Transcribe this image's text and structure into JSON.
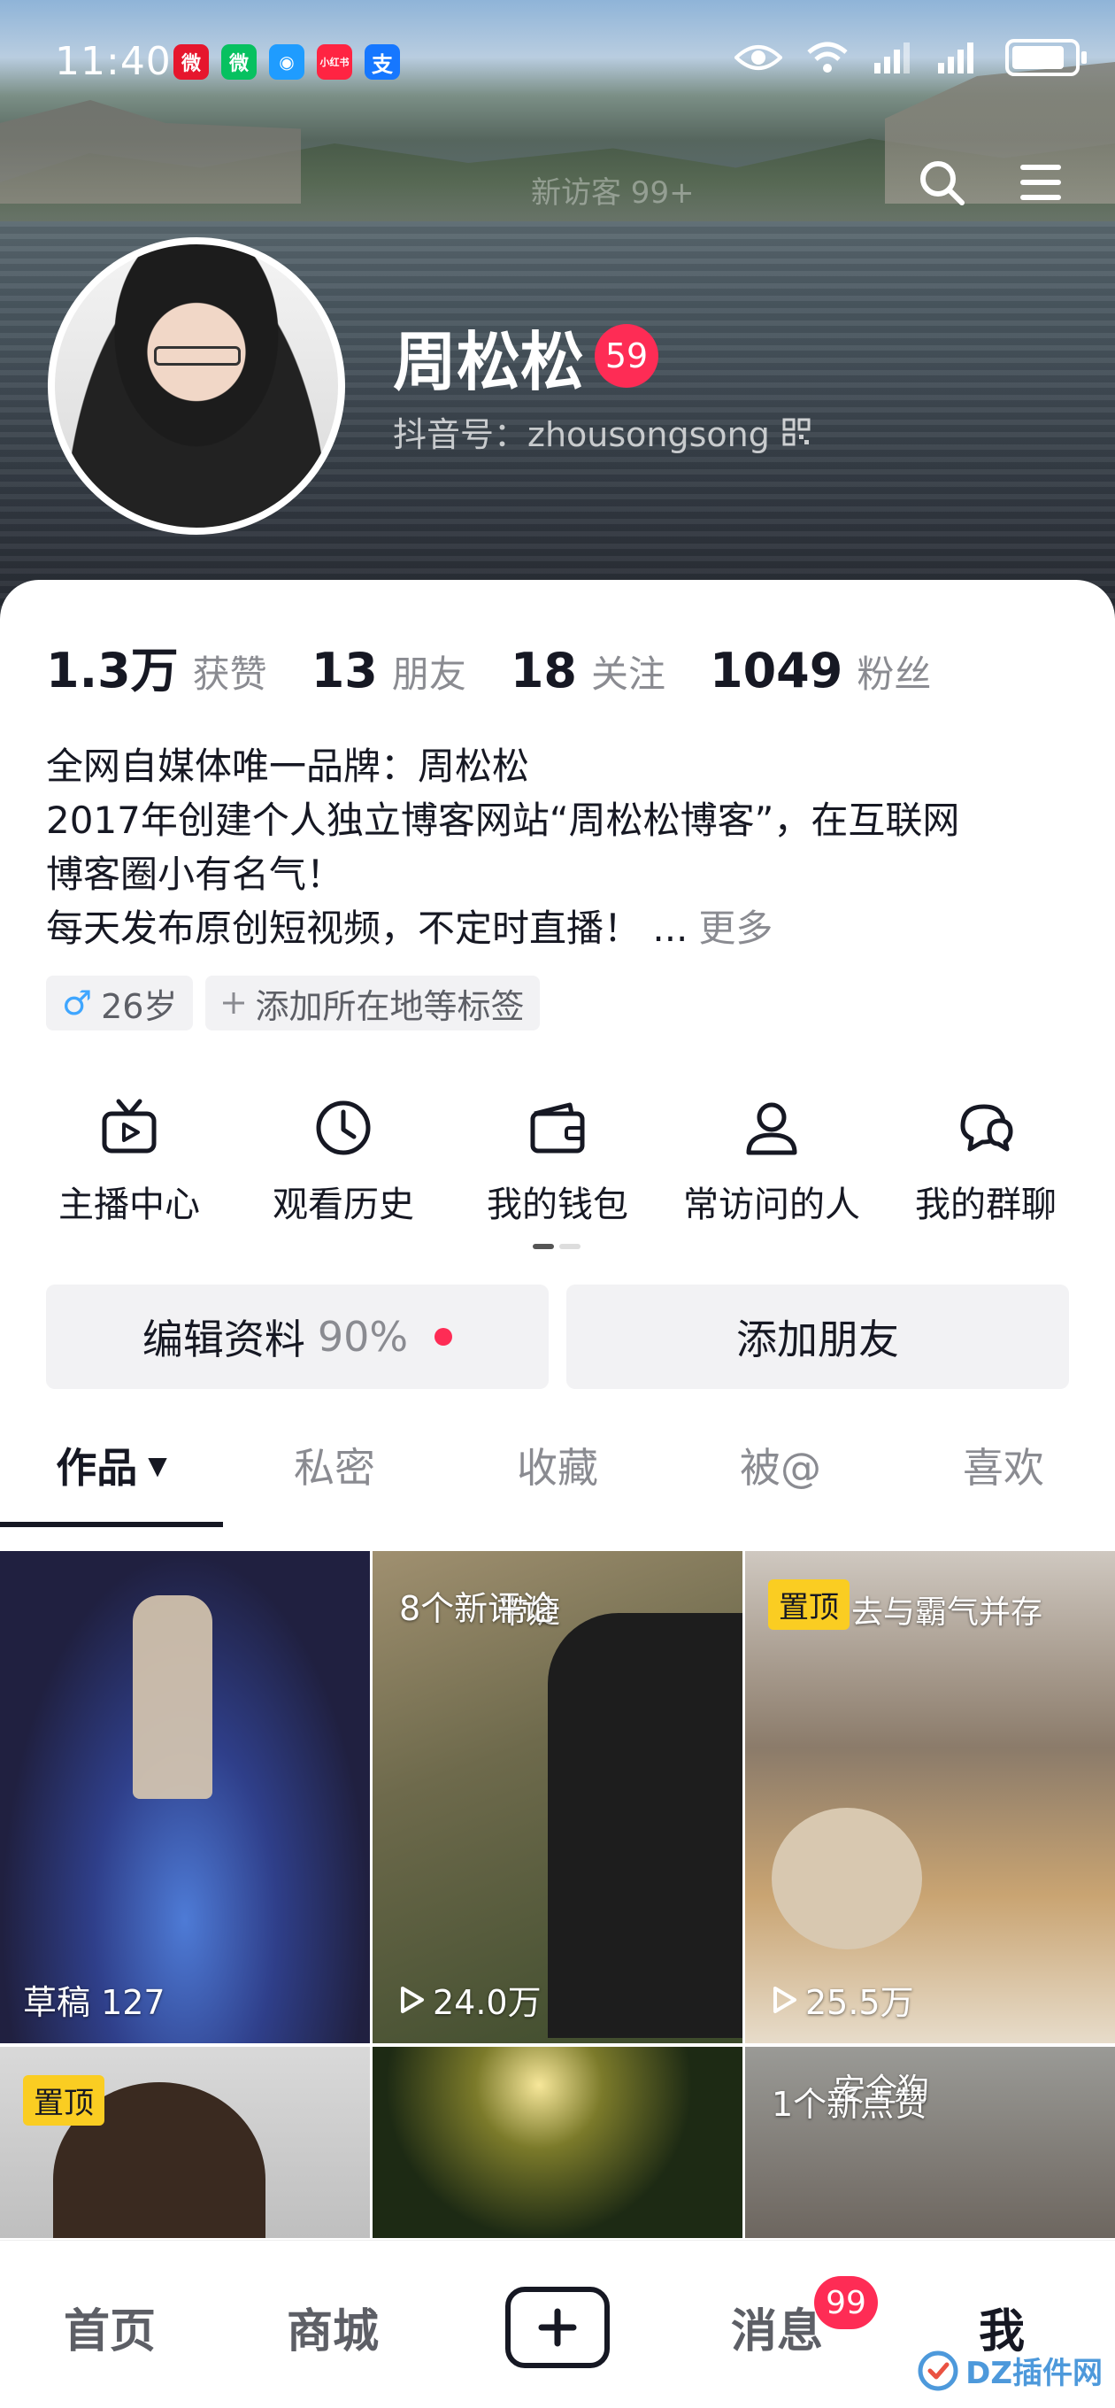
{
  "status_bar": {
    "time": "11:40",
    "notification_apps": [
      {
        "icon": "weibo-icon",
        "glyph": "微",
        "color": "#e6162d"
      },
      {
        "icon": "wechat-icon",
        "glyph": "微",
        "color": "#07c160"
      },
      {
        "icon": "chat-bubble-icon",
        "glyph": "◉",
        "color": "#1f9cff"
      },
      {
        "icon": "xiaohongshu-icon",
        "glyph": "小红书",
        "color": "#ff2442"
      },
      {
        "icon": "alipay-icon",
        "glyph": "支",
        "color": "#1677ff"
      }
    ]
  },
  "banner": {
    "watermark": "新访客 99+"
  },
  "profile": {
    "name": "周松松",
    "level": "59",
    "douyin_id": "抖音号：zhousongsong"
  },
  "stats": [
    {
      "num": "1.3万",
      "label": "获赞"
    },
    {
      "num": "13",
      "label": "朋友"
    },
    {
      "num": "18",
      "label": "关注"
    },
    {
      "num": "1049",
      "label": "粉丝"
    }
  ],
  "bio": {
    "lines": [
      "全网自媒体唯一品牌：周松松",
      "2017年创建个人独立博客网站“周松松博客”，在互联网",
      "博客圈小有名气！",
      "每天发布原创短视频，不定时直播！ ..."
    ],
    "more": "更多"
  },
  "tags": {
    "gender_symbol": "♂",
    "age": "26岁",
    "add_location": "添加所在地等标签"
  },
  "shortcuts": [
    {
      "label": "主播中心",
      "icon": "tv-icon"
    },
    {
      "label": "观看历史",
      "icon": "clock-icon"
    },
    {
      "label": "我的钱包",
      "icon": "wallet-icon"
    },
    {
      "label": "常访问的人",
      "icon": "person-icon"
    },
    {
      "label": "我的群聊",
      "icon": "group-chat-icon"
    }
  ],
  "buttons": {
    "edit_profile": "编辑资料",
    "edit_percent": "90%",
    "add_friend": "添加朋友"
  },
  "tabs": [
    "作品",
    "私密",
    "收藏",
    "被@",
    "喜欢"
  ],
  "videos": [
    {
      "bottom": "草稿 127"
    },
    {
      "top_note": "8个新评论",
      "overlay": "带婕",
      "plays": "24.0万"
    },
    {
      "pin": "置顶",
      "overlay": "去与霸气并存",
      "plays": "25.5万"
    },
    {
      "pin": "置顶"
    },
    {},
    {
      "top_note": "1个新点赞",
      "overlay": "安全狗"
    }
  ],
  "bottom_nav": {
    "home": "首页",
    "mall": "商城",
    "messages": "消息",
    "messages_badge": "99",
    "me": "我"
  },
  "corner_watermark": "DZ插件网",
  "colors": {
    "accent_red": "#fe2c55",
    "pin_yellow": "#facd22",
    "text_primary": "#161823",
    "text_secondary": "#8a8b91"
  },
  "battery_level": 0.85
}
